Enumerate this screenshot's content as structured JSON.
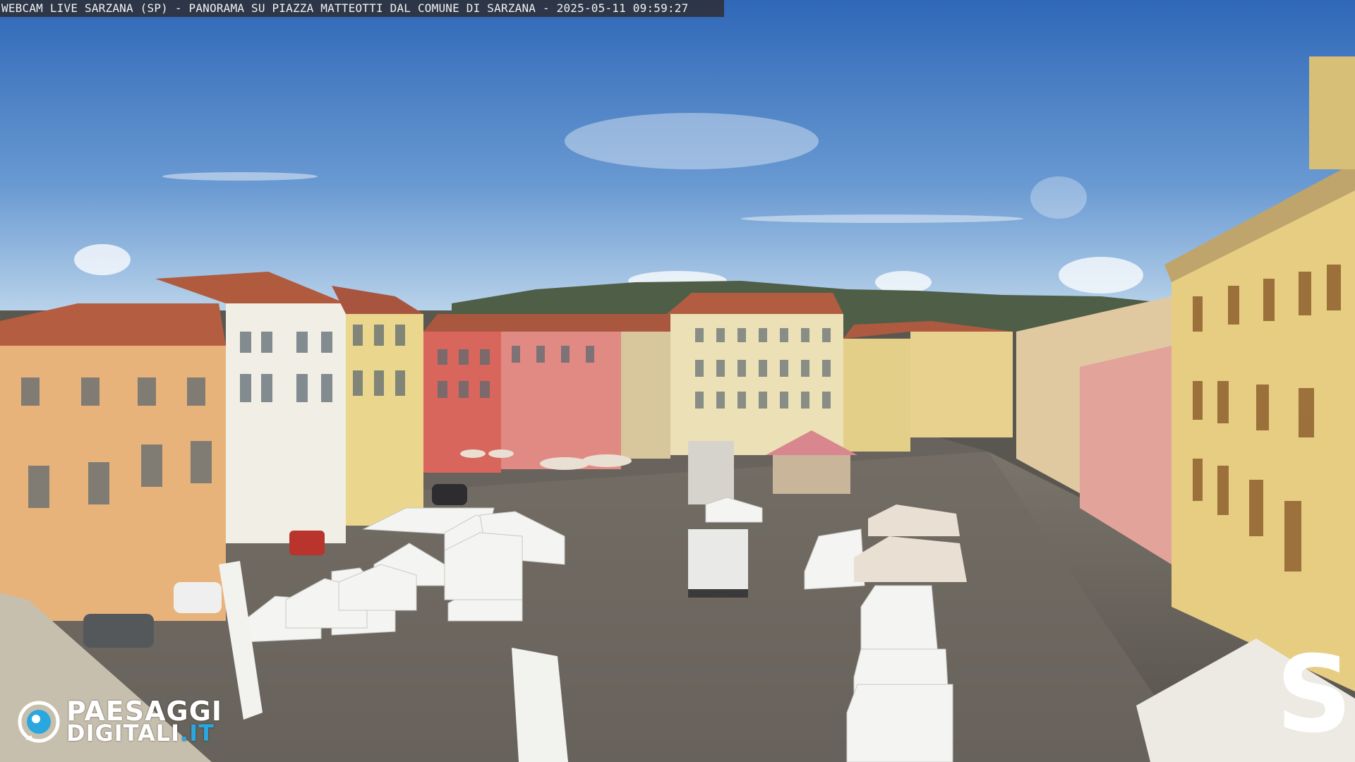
{
  "overlay": {
    "title": "WEBCAM LIVE SARZANA (SP) - PANORAMA SU PIAZZA MATTEOTTI DAL COMUNE DI SARZANA - 2025-05-11  09:59:27"
  },
  "logo": {
    "line1": "PAESAGGI",
    "line2": "DIGITALI",
    "suffix": ".IT",
    "accent_color": "#2aa7df"
  },
  "brand_mark": {
    "letter": "S"
  },
  "colors": {
    "sky_top": "#3f78c4",
    "sky_bottom": "#a9c8e6",
    "pavement": "#6b6760",
    "building_orange": "#e8b37a",
    "building_yellow": "#e9d69a",
    "building_red": "#d9685e",
    "building_pink": "#e08a83",
    "roof": "#b35a3e"
  }
}
